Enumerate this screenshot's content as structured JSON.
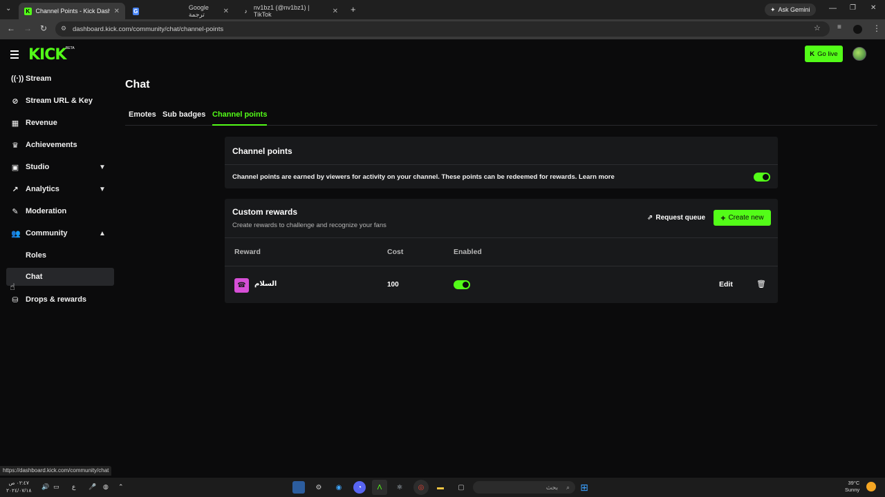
{
  "browser": {
    "tabs": [
      {
        "title": "Channel Points - Kick Dashboa",
        "active": true
      },
      {
        "title": "",
        "active": false
      },
      {
        "title": "Google ترجمة",
        "active": false
      },
      {
        "title": "nv1bz1 (@nv1bz1) | TikTok",
        "active": false
      }
    ],
    "new_tab": "+",
    "ask_gemini": "Ask Gemini",
    "url": "dashboard.kick.com/community/chat/channel-points",
    "status_url": "https://dashboard.kick.com/community/chat"
  },
  "header": {
    "logo": "KICK",
    "beta": "BETA",
    "go_live": "Go live"
  },
  "sidebar": {
    "items": [
      {
        "label": "Stream",
        "icon": "broadcast-icon"
      },
      {
        "label": "Stream URL & Key",
        "icon": "link-icon"
      },
      {
        "label": "Revenue",
        "icon": "revenue-icon"
      },
      {
        "label": "Achievements",
        "icon": "trophy-icon"
      },
      {
        "label": "Studio",
        "icon": "studio-icon"
      },
      {
        "label": "Analytics",
        "icon": "analytics-icon"
      },
      {
        "label": "Moderation",
        "icon": "wrench-icon"
      },
      {
        "label": "Community",
        "icon": "community-icon"
      },
      {
        "label": "Roles",
        "icon": ""
      },
      {
        "label": "Chat",
        "icon": ""
      },
      {
        "label": "Drops & rewards",
        "icon": "drops-icon"
      }
    ]
  },
  "main": {
    "title": "Chat",
    "tabs": [
      "Emotes",
      "Sub badges",
      "Channel points"
    ],
    "channel_points": {
      "heading": "Channel points",
      "description": "Channel points are earned by viewers for activity on your channel. These points can be redeemed for rewards. Learn more",
      "enabled": true
    },
    "custom_rewards": {
      "heading": "Custom rewards",
      "subtitle": "Create rewards to challenge and recognize your fans",
      "request_queue": "Request queue",
      "create_new": "Create new",
      "columns": [
        "Reward",
        "Cost",
        "Enabled"
      ],
      "rows": [
        {
          "name": "السلام",
          "cost": "100",
          "enabled": true,
          "edit": "Edit"
        }
      ]
    }
  },
  "taskbar": {
    "time": "٠٢:٤٧ ص",
    "date": "٢٠٢٤/٠٧/١٨",
    "lang": "ع",
    "search_placeholder": "بحث",
    "weather_temp": "39°C",
    "weather_desc": "Sunny"
  },
  "colors": {
    "accent": "#53fc18",
    "background": "#0b0b0c",
    "card": "#18191b"
  }
}
